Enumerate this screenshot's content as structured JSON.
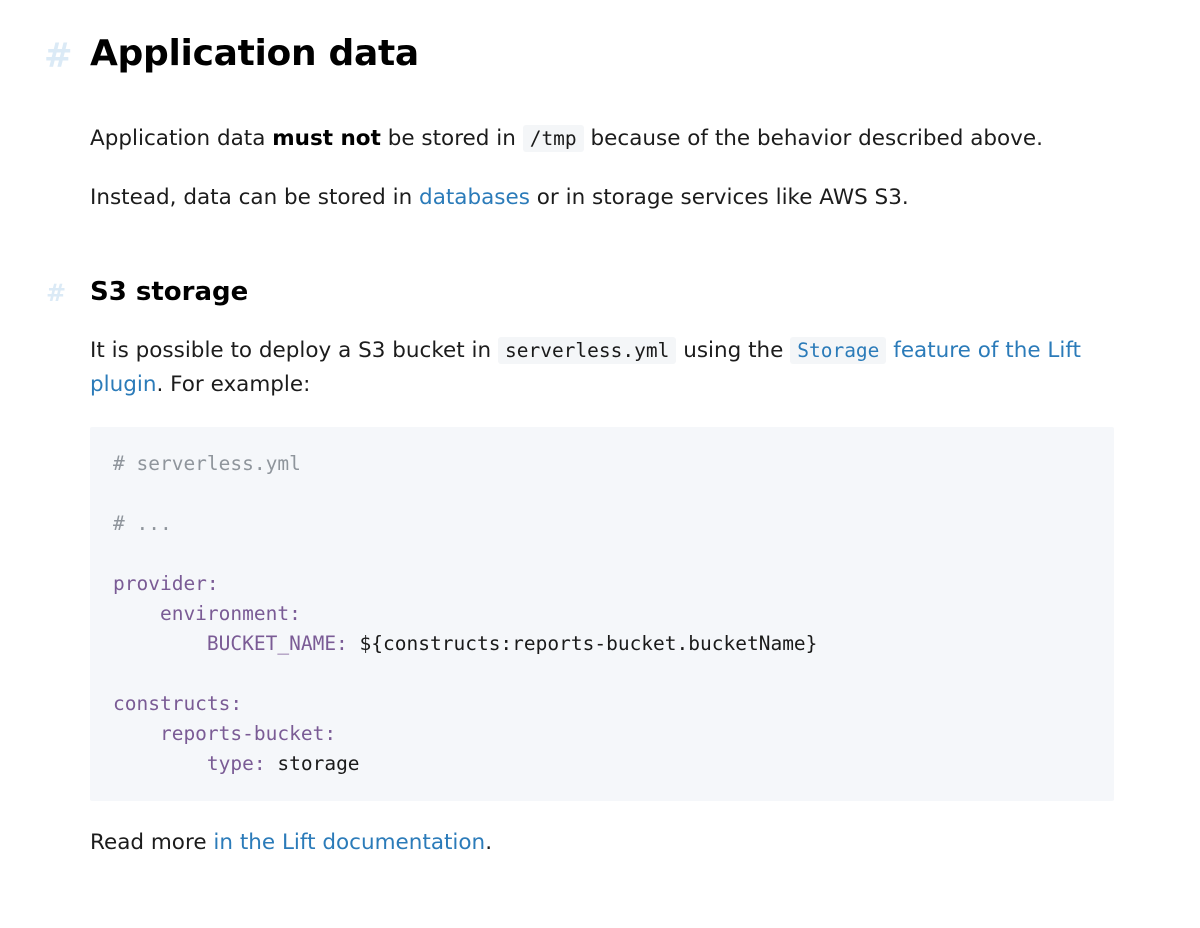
{
  "h1": {
    "anchor": "#",
    "title": "Application data"
  },
  "p1": {
    "t1": "Application data ",
    "bold": "must not",
    "t2": " be stored in ",
    "code": "/tmp",
    "t3": " because of the behavior described above."
  },
  "p2": {
    "t1": "Instead, data can be stored in ",
    "link": "databases",
    "t2": " or in storage services like AWS S3."
  },
  "h2": {
    "anchor": "#",
    "title": "S3 storage"
  },
  "p3": {
    "t1": "It is possible to deploy a S3 bucket in ",
    "code": "serverless.yml",
    "t2": " using the ",
    "link_code": "Storage",
    "link_text": " feature of the Lift plugin",
    "t3": ". For example:"
  },
  "code": {
    "l1": "# serverless.yml",
    "l2": "# ...",
    "l3": "provider:",
    "l4": "    environment:",
    "l5_key": "        BUCKET_NAME:",
    "l5_val": " ${constructs:reports-bucket.bucketName}",
    "l6": "constructs:",
    "l7": "    reports-bucket:",
    "l8_key": "        type:",
    "l8_val": " storage"
  },
  "p4": {
    "t1": "Read more ",
    "link": "in the Lift documentation",
    "t2": "."
  },
  "colors": {
    "link": "#2b7bb9",
    "anchor": "#dbeaf6",
    "code_bg": "#f5f7fa",
    "code_key": "#7a5b95",
    "code_comment": "#8f959c"
  }
}
